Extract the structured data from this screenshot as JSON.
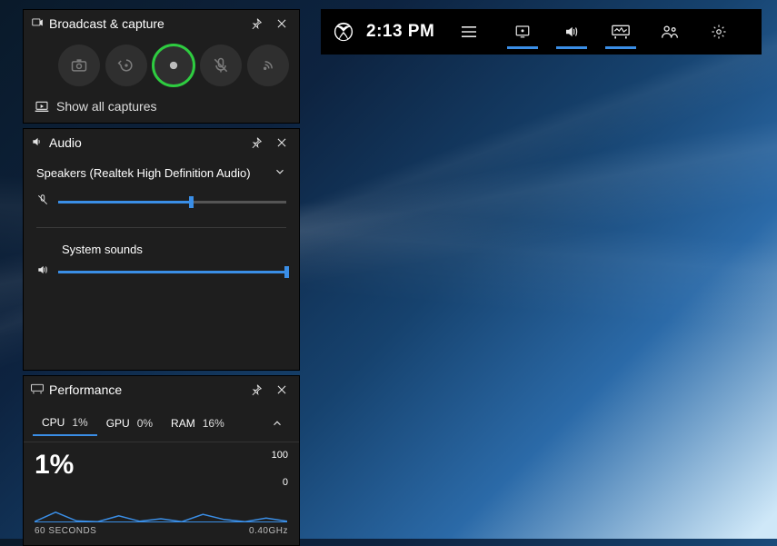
{
  "topbar": {
    "time": "2:13 PM",
    "tools": [
      "capture",
      "audio",
      "performance",
      "social",
      "settings"
    ]
  },
  "capture": {
    "title": "Broadcast & capture",
    "show_all": "Show all captures"
  },
  "audio": {
    "title": "Audio",
    "device": "Speakers (Realtek High Definition Audio)",
    "mic_level": 58,
    "system_label": "System sounds",
    "system_level": 100
  },
  "performance": {
    "title": "Performance",
    "tabs": {
      "cpu_label": "CPU",
      "cpu_val": "1%",
      "gpu_label": "GPU",
      "gpu_val": "0%",
      "ram_label": "RAM",
      "ram_val": "16%"
    },
    "big_value": "1%",
    "y_max": "100",
    "y_min": "0",
    "x_label": "60 SECONDS",
    "freq": "0.40GHz"
  },
  "chart_data": {
    "type": "line",
    "title": "CPU %",
    "xlabel": "60 SECONDS",
    "ylabel": "%",
    "ylim": [
      0,
      100
    ],
    "x": [
      0,
      5,
      10,
      15,
      20,
      25,
      30,
      35,
      40,
      45,
      50,
      55,
      60
    ],
    "values": [
      2,
      28,
      4,
      2,
      18,
      3,
      10,
      2,
      22,
      8,
      2,
      12,
      3
    ]
  }
}
